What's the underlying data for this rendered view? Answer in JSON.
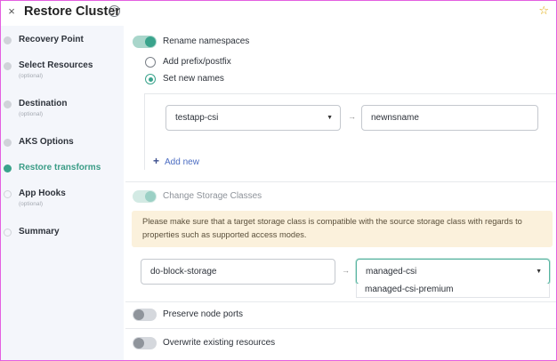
{
  "header": {
    "title": "Restore Cluster",
    "help_glyph": "?",
    "close_glyph": "×",
    "star_glyph": "☆"
  },
  "sidebar": {
    "steps": [
      {
        "label": "Recovery Point",
        "sub": ""
      },
      {
        "label": "Select Resources",
        "sub": "(optional)"
      },
      {
        "label": "Destination",
        "sub": "(optional)"
      },
      {
        "label": "AKS Options",
        "sub": ""
      },
      {
        "label": "Restore transforms",
        "sub": "",
        "active": true
      },
      {
        "label": "App Hooks",
        "sub": "(optional)"
      },
      {
        "label": "Summary",
        "sub": ""
      }
    ]
  },
  "namespaces": {
    "toggle_label": "Rename namespaces",
    "enabled": true,
    "option_prefix": "Add prefix/postfix",
    "option_new": "Set new names",
    "selected": "Set new names",
    "source_select": "testapp-csi",
    "target_input": "newnsname",
    "arrow": "→",
    "add_new": "Add new",
    "add_glyph": "+"
  },
  "storage": {
    "toggle_label": "Change Storage Classes",
    "enabled": true,
    "warning": "Please make sure that a target storage class is compatible with the source storage class with regards to properties such as supported access modes.",
    "source_input": "do-block-storage",
    "arrow": "→",
    "target_select": "managed-csi",
    "dropdown_option": "managed-csi-premium"
  },
  "other": {
    "preserve_ports": "Preserve node ports",
    "overwrite": "Overwrite existing resources"
  },
  "colors": {
    "accent": "#3aa38c",
    "warning_bg": "#fbf1dc",
    "link": "#4b6cc2"
  }
}
